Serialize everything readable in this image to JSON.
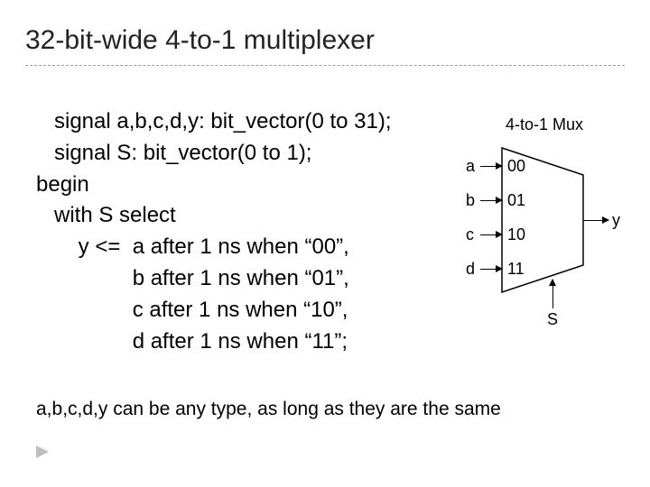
{
  "title": "32-bit-wide 4-to-1 multiplexer",
  "code": {
    "l1": "   signal a,b,c,d,y: bit_vector(0 to 31);",
    "l2": "   signal S: bit_vector(0 to 1);",
    "l3": "begin",
    "l4": "   with S select",
    "l5": "       y <=  a after 1 ns when “00”,",
    "l6": "                b after 1 ns when “01”,",
    "l7": "                c after 1 ns when “10”,",
    "l8": "                d after 1 ns when “11”;"
  },
  "note": "a,b,c,d,y can be any type, as long as they are the same",
  "mux": {
    "title": "4-to-1 Mux",
    "inputs": [
      "a",
      "b",
      "c",
      "d"
    ],
    "selects": [
      "00",
      "01",
      "10",
      "11"
    ],
    "output": "y",
    "sel_label": "S"
  }
}
